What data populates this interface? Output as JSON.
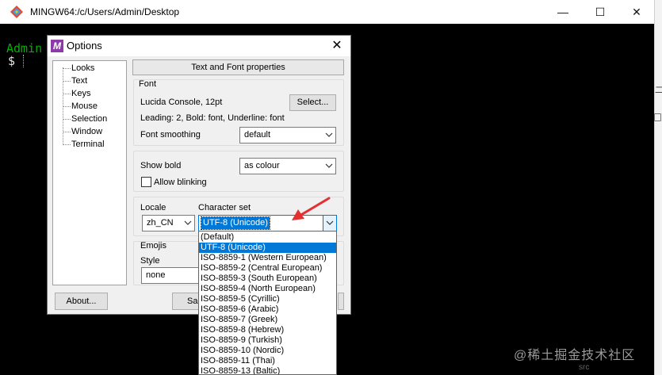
{
  "mintty": {
    "title": "MINGW64:/c/Users/Admin/Desktop",
    "prompt_name": "Admin",
    "prompt_symbol": "$",
    "minimize_glyph": "—",
    "maximize_glyph": "☐",
    "close_glyph": "✕"
  },
  "edge": {
    "fragment": "二",
    "bottom_fragment": "src"
  },
  "watermark": "@稀土掘金技术社区",
  "dialog": {
    "title": "Options",
    "icon_letter": "M",
    "close_glyph": "✕",
    "tree_items": [
      "Looks",
      "Text",
      "Keys",
      "Mouse",
      "Selection",
      "Window",
      "Terminal"
    ],
    "selected_item": "Text",
    "header": "Text and Font properties",
    "font_group": {
      "title": "Font",
      "font_name": "Lucida Console, 12pt",
      "select_button": "Select...",
      "font_details": "Leading: 2, Bold: font, Underline: font",
      "smoothing_label": "Font smoothing",
      "smoothing_value": "default"
    },
    "bold_group": {
      "show_bold_label": "Show bold",
      "show_bold_value": "as colour",
      "blinking_label": "Allow blinking",
      "blinking_checked": false
    },
    "locale_group": {
      "locale_label": "Locale",
      "locale_value": "zh_CN",
      "charset_label": "Character set",
      "charset_value": "UTF-8 (Unicode)"
    },
    "emojis_group": {
      "title": "Emojis",
      "style_label": "Style",
      "style_value": "none"
    },
    "about_button": "About...",
    "save_button_partial": "Sa"
  },
  "charset_options": [
    "(Default)",
    "UTF-8 (Unicode)",
    "ISO-8859-1 (Western European)",
    "ISO-8859-2 (Central European)",
    "ISO-8859-3 (South European)",
    "ISO-8859-4 (North European)",
    "ISO-8859-5 (Cyrillic)",
    "ISO-8859-6 (Arabic)",
    "ISO-8859-7 (Greek)",
    "ISO-8859-8 (Hebrew)",
    "ISO-8859-9 (Turkish)",
    "ISO-8859-10 (Nordic)",
    "ISO-8859-11 (Thai)",
    "ISO-8859-13 (Baltic)"
  ],
  "charset_selected": "UTF-8 (Unicode)",
  "colors": {
    "selection": "#0078d7",
    "prompt_green": "#00b000",
    "annotation_red": "#e53030",
    "mintty_icon_purple": "#8c3aa7"
  },
  "icons": {
    "mintty_icon": "git-bash-diamond-icon",
    "dialog_icon": "mintty-m-icon",
    "dropdown_arrow": "chevron-down-icon",
    "annotation": "red-arrow-icon"
  }
}
